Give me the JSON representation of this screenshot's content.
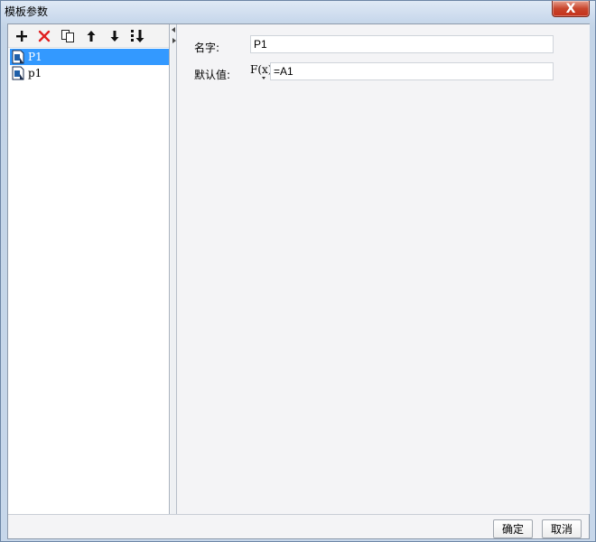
{
  "window": {
    "title": "模板参数",
    "close_glyph": "X"
  },
  "toolbar": {
    "buttons": [
      {
        "name": "add-icon",
        "label": "add"
      },
      {
        "name": "delete-icon",
        "label": "delete"
      },
      {
        "name": "copy-icon",
        "label": "copy"
      },
      {
        "name": "move-up-icon",
        "label": "move up"
      },
      {
        "name": "move-down-icon",
        "label": "move down"
      },
      {
        "name": "import-icon",
        "label": "import"
      }
    ]
  },
  "parameters": {
    "items": [
      {
        "label": "P1",
        "selected": true
      },
      {
        "label": "p1",
        "selected": false
      }
    ]
  },
  "form": {
    "name_label": "名字:",
    "name_value": "P1",
    "default_label": "默认值:",
    "formula_icon": "F(x)",
    "default_value": "=A1"
  },
  "buttons": {
    "ok": "确定",
    "cancel": "取消"
  },
  "colors": {
    "selection": "#3399ff",
    "close_button": "#c8452c",
    "delete_icon": "#e02020"
  }
}
